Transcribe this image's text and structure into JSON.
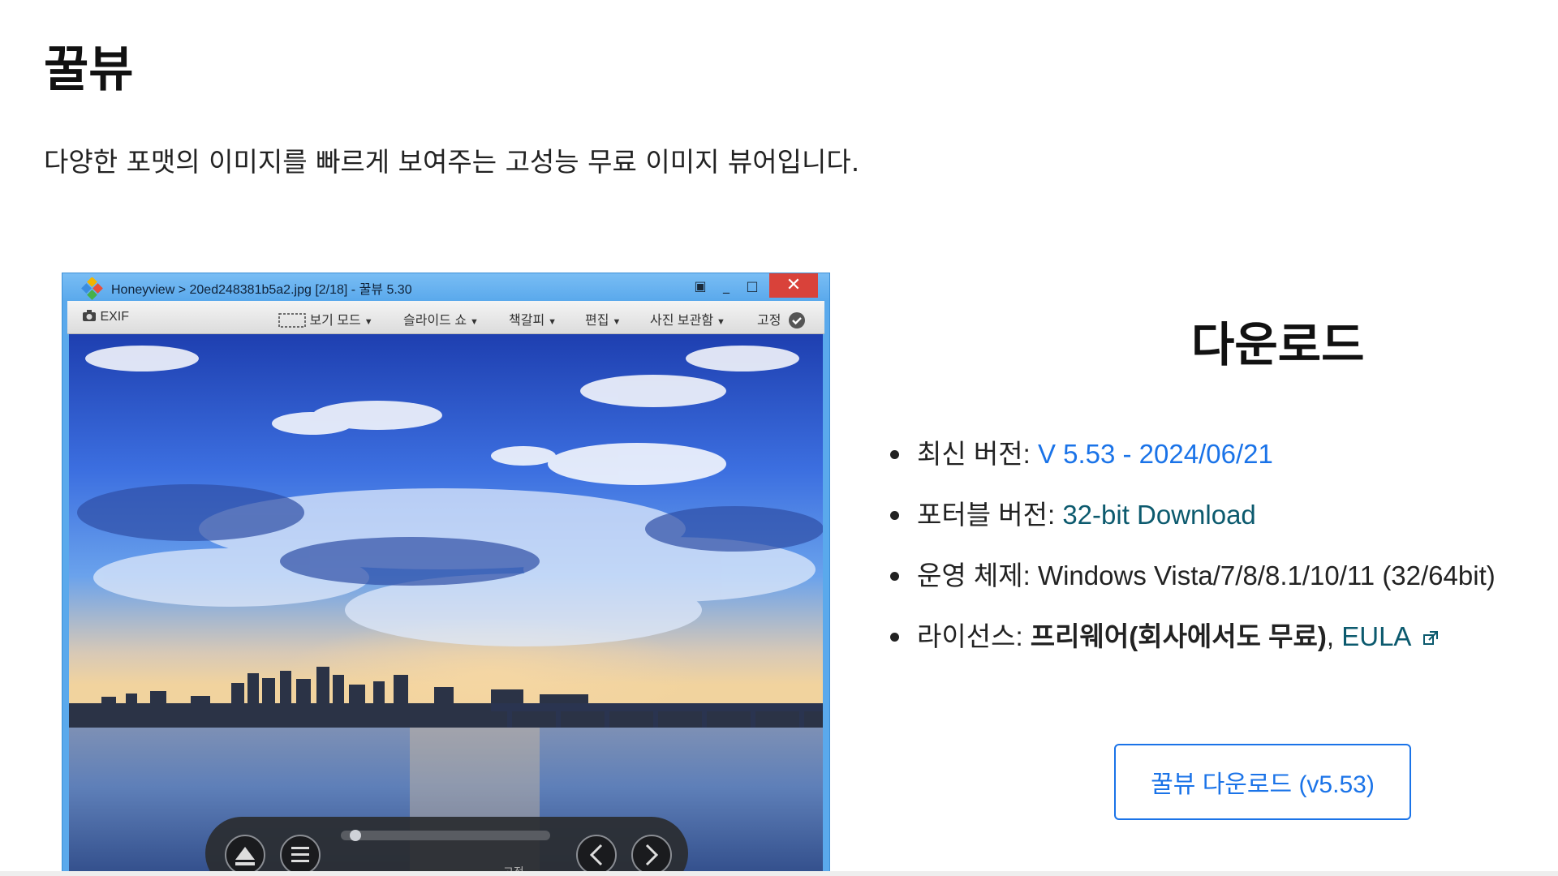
{
  "page": {
    "title": "꿀뷰",
    "description": "다양한 포맷의 이미지를 빠르게 보여주는 고성능 무료 이미지 뷰어입니다."
  },
  "viewer_window": {
    "title": "Honeyview > 20ed248381b5a2.jpg [2/18] - 꿀뷰 5.30",
    "close_glyph": "✕",
    "toolbar": {
      "exif": "EXIF",
      "view_mode": "보기 모드",
      "slideshow": "슬라이드 쇼",
      "bookmark": "책갈피",
      "edit": "편집",
      "photo_box": "사진 보관함",
      "pin": "고정"
    },
    "overlay_pin": "고정"
  },
  "download": {
    "title": "다운로드",
    "items": [
      {
        "label": "최신 버전: ",
        "value": "V 5.53 - 2024/06/21"
      },
      {
        "label": "포터블 버전: ",
        "value": "32-bit Download"
      },
      {
        "label": "운영 체제: ",
        "value": "Windows Vista/7/8/8.1/10/11 (32/64bit)"
      },
      {
        "label": "라이선스: ",
        "bold": "프리웨어(회사에서도 무료)",
        "sep": ", ",
        "link": "EULA"
      }
    ],
    "button_label": "꿀뷰 다운로드 (v5.53)"
  },
  "colors": {
    "link_blue": "#1a73e8",
    "link_teal": "#0c5a6e",
    "window_frame": "#5aa9ec",
    "close_red": "#d9423a"
  }
}
